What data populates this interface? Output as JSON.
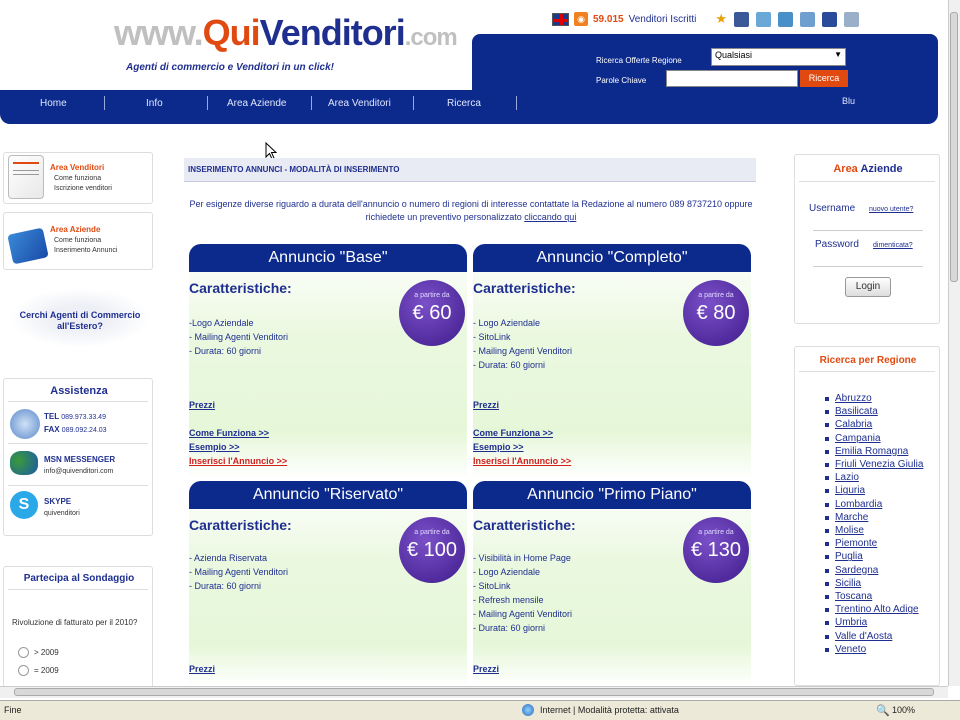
{
  "header": {
    "logo": {
      "www": "www.",
      "qui": "Qui",
      "vend": "Venditori",
      "com": ".com"
    },
    "tagline": "Agenti di commercio e Venditori in un click!",
    "subscriber_count": "59.015",
    "subscriber_label": "Venditori Iscritti",
    "search_region_label": "Ricerca Offerte Regione",
    "region_select_value": "Qualsiasi",
    "keyword_label": "Parole Chiave",
    "keyword_value": "",
    "search_button": "Ricerca"
  },
  "nav": {
    "items": [
      "Home",
      "Info",
      "Area Aziende",
      "Area Venditori",
      "Ricerca"
    ],
    "right_text": "Blu"
  },
  "left": {
    "vendor_box": {
      "title": "Area Venditori",
      "line1": "Come funziona",
      "line2": "Iscrizione venditori"
    },
    "company_box": {
      "title": "Area Aziende",
      "line1": "Come funziona",
      "line2": "Inserimento Annunci"
    },
    "abroad": "Cerchi Agenti di Commercio all'Estero?",
    "assistance": {
      "title": "Assistenza",
      "tel_label": "TEL",
      "tel": "089.973.33.49",
      "fax_label": "FAX",
      "fax": "089.092.24.03",
      "msn_title": "MSN MESSENGER",
      "msn": "info@quivenditori.com",
      "skype_title": "SKYPE",
      "skype": "quivenditori"
    },
    "poll": {
      "title": "Partecipa al Sondaggio",
      "question": "Rivoluzione di fatturato per il 2010?",
      "options": [
        "> 2009",
        "= 2009"
      ]
    }
  },
  "center": {
    "breadcrumb": "INSERIMENTO ANNUNCI - MODALITÀ DI INSERIMENTO",
    "intro_text": "Per esigenze diverse riguardo a durata dell'annuncio o numero di regioni di interesse contattate la Redazione al numero 089 8737210 oppure richiedete un preventivo personalizzato",
    "intro_link": "cliccando qui",
    "features_title": "Caratteristiche:",
    "price_prefix": "a partire da",
    "links": {
      "prices": "Prezzi",
      "how": "Come Funziona >>",
      "example": "Esempio >>",
      "insert": "Inserisci l'Annuncio >>"
    },
    "cards": [
      {
        "title": "Annuncio \"Base\"",
        "price": "€ 60",
        "features": [
          "-Logo Aziendale",
          "- Mailing Agenti Venditori",
          "- Durata: 60 giorni"
        ]
      },
      {
        "title": "Annuncio \"Completo\"",
        "price": "€ 80",
        "features": [
          "- Logo Aziendale",
          "- SitoLink",
          "- Mailing Agenti Venditori",
          "- Durata: 60 giorni"
        ]
      },
      {
        "title": "Annuncio \"Riservato\"",
        "price": "€ 100",
        "features": [
          "- Azienda Riservata",
          "- Mailing Agenti Venditori",
          "- Durata: 60 giorni"
        ]
      },
      {
        "title": "Annuncio \"Primo Piano\"",
        "price": "€ 130",
        "features": [
          "- Visibilità in Home Page",
          "- Logo Aziendale",
          "- SitoLink",
          "- Refresh mensile",
          "- Mailing Agenti Venditori",
          "- Durata: 60 giorni"
        ]
      }
    ]
  },
  "right": {
    "login": {
      "title_a": "Area",
      "title_b": "Aziende",
      "username": "Username",
      "username_link": "nuovo utente?",
      "password": "Password",
      "password_link": "dimenticata?",
      "button": "Login"
    },
    "regions": {
      "title": "Ricerca per Regione",
      "items": [
        "Abruzzo",
        "Basilicata",
        "Calabria",
        "Campania",
        "Emilia Romagna",
        "Friuli Venezia Giulia",
        "Lazio",
        "Liguria",
        "Lombardia",
        "Marche",
        "Molise",
        "Piemonte",
        "Puglia",
        "Sardegna",
        "Sicilia",
        "Toscana",
        "Trentino Alto Adige",
        "Umbria",
        "Valle d'Aosta",
        "Veneto"
      ]
    }
  },
  "statusbar": {
    "left": "Fine",
    "zone": "Internet | Modalità protetta: attivata",
    "zoom": "100%"
  }
}
